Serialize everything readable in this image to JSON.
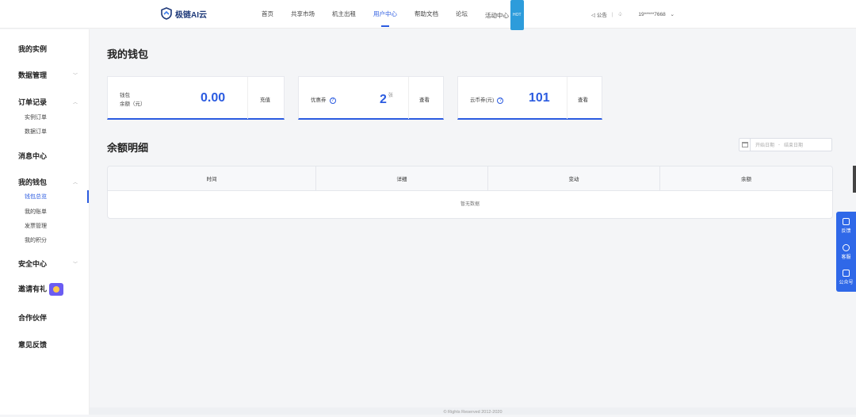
{
  "brand": {
    "name": "极链AI云"
  },
  "nav": {
    "items": [
      {
        "label": "首页"
      },
      {
        "label": "共享市场"
      },
      {
        "label": "机主出租"
      },
      {
        "label": "用户中心"
      },
      {
        "label": "帮助文档"
      },
      {
        "label": "论坛"
      },
      {
        "label": "活动中心"
      }
    ],
    "hot_badge": "HOT",
    "announce": "公告",
    "user": "19*****7668"
  },
  "sidebar": {
    "instances": "我的实例",
    "data": "数据管理",
    "orders": "订单记录",
    "orders_sub": [
      "实例订单",
      "数据订单"
    ],
    "messages": "消息中心",
    "wallet": "我的钱包",
    "wallet_sub": [
      "钱包总览",
      "我的账单",
      "发票管理",
      "我的积分"
    ],
    "security": "安全中心",
    "invite": "邀请有礼",
    "partners": "合作伙伴",
    "feedback": "意见反馈"
  },
  "page": {
    "title": "我的钱包"
  },
  "cards": {
    "balance_label_1": "钱包",
    "balance_label_2": "余额（元）",
    "balance_value": "0.00",
    "balance_action": "充值",
    "coupon_label": "优惠券",
    "coupon_value": "2",
    "coupon_unit": "张",
    "coupon_action": "查看",
    "coins_label": "云币券(元)",
    "coins_value": "101",
    "coins_action": "查看"
  },
  "detail": {
    "title": "余额明细",
    "start_placeholder": "开始日期",
    "range_sep": "-",
    "end_placeholder": "结束日期",
    "columns": [
      "时间",
      "详细",
      "变动",
      "余额"
    ],
    "empty": "暂无数据"
  },
  "float": {
    "feedback": "反馈",
    "service": "客服",
    "wechat": "公众号"
  },
  "footer": {
    "text": "© Rights Reserved 2012-2020"
  }
}
